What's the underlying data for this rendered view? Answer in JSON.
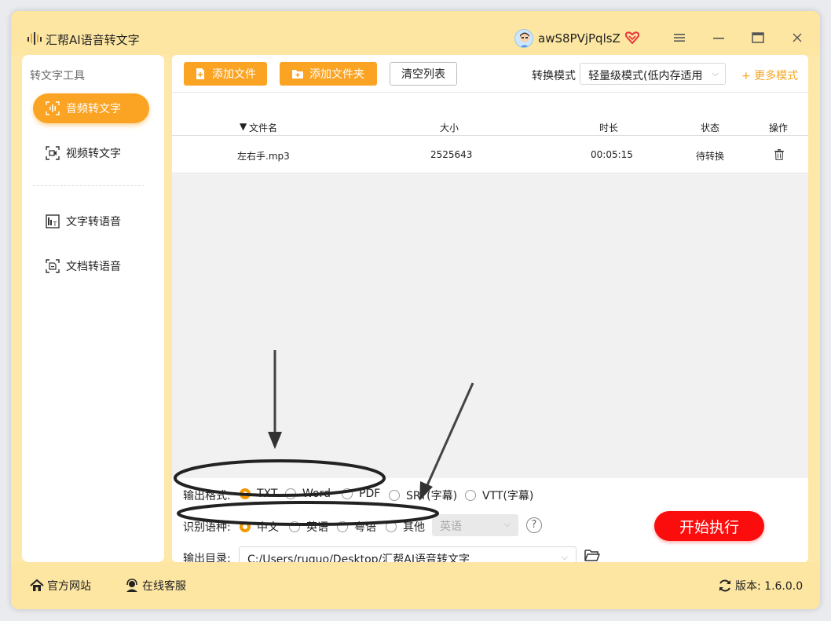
{
  "titlebar": {
    "app_title": "汇帮AI语音转文字",
    "user_name": "awS8PVjPqlsZ",
    "icons": [
      "app-logo-icon",
      "avatar",
      "vip-heart-icon",
      "menu-icon",
      "minimize-icon",
      "maximize-icon",
      "close-icon"
    ]
  },
  "sidebar": {
    "heading": "转文字工具",
    "items": [
      {
        "label": "音频转文字",
        "icon": "audio-waveform-icon",
        "active": true
      },
      {
        "label": "视频转文字",
        "icon": "video-scan-icon",
        "active": false
      },
      {
        "label": "文字转语音",
        "icon": "text-to-speech-icon",
        "active": false
      },
      {
        "label": "文档转语音",
        "icon": "document-scan-icon",
        "active": false
      }
    ]
  },
  "toolbar": {
    "add_file": "添加文件",
    "add_folder": "添加文件夹",
    "clear_list": "清空列表",
    "mode_label": "转换模式",
    "mode_value": "轻量级模式(低内存适用",
    "more_modes": "+ 更多模式"
  },
  "table": {
    "columns": [
      "文件名",
      "大小",
      "时长",
      "状态",
      "操作"
    ],
    "rows": [
      {
        "name": "左右手.mp3",
        "size": "2525643",
        "duration": "00:05:15",
        "status": "待转换"
      }
    ]
  },
  "settings": {
    "format_label": "输出格式:",
    "formats": [
      "TXT",
      "Word",
      "PDF",
      "SRT(字幕)",
      "VTT(字幕)"
    ],
    "format_selected": "TXT",
    "lang_label": "识别语种:",
    "languages": [
      "中文",
      "英语",
      "粤语",
      "其他"
    ],
    "lang_selected": "中文",
    "other_lang_value": "英语",
    "help": "?",
    "start_button": "开始执行",
    "dir_label": "输出目录:",
    "dir_value": "C:/Users/ruguo/Desktop/汇帮AI语音转文字"
  },
  "footer": {
    "website": "官方网站",
    "support": "在线客服",
    "version": "版本: 1.6.0.0"
  },
  "colors": {
    "frame": "#fde6a2",
    "accent": "#fba322",
    "start": "#fb0d0d",
    "radio": "#f39800"
  }
}
